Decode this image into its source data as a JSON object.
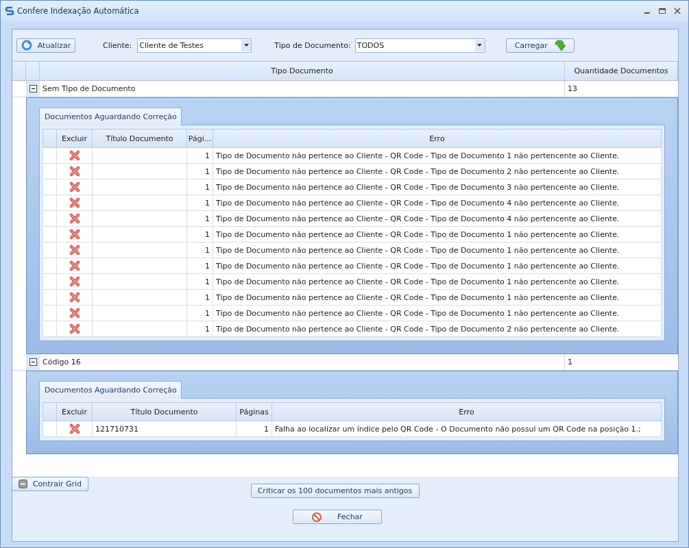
{
  "window": {
    "title": "Confere Indexação Automática"
  },
  "toolbar": {
    "refresh_button": "Atualizar",
    "client_label": "Cliente:",
    "client_value": "Cliente de Testes",
    "doctype_label": "Tipo de Documento:",
    "doctype_value": "TODOS",
    "load_button": "Carregar"
  },
  "grid": {
    "columns": [
      "Tipo Documento",
      "Quantidade Documentos"
    ],
    "groups": [
      {
        "name": "Sem Tipo de Documento",
        "count": "13",
        "expanded": true,
        "detail": {
          "tab": "Documentos Aguardando Correção",
          "columns": [
            "Excluir",
            "Título Documento",
            "Pági...",
            "Erro"
          ],
          "rows": [
            {
              "pages": "1",
              "error": "Tipo de Documento não pertence ao Cliente - QR Code - Tipo de Documento 1 não pertencente ao Cliente."
            },
            {
              "pages": "1",
              "error": "Tipo de Documento não pertence ao Cliente - QR Code - Tipo de Documento 2 não pertencente ao Cliente."
            },
            {
              "pages": "1",
              "error": "Tipo de Documento não pertence ao Cliente - QR Code - Tipo de Documento 3 não pertencente ao Cliente."
            },
            {
              "pages": "1",
              "error": "Tipo de Documento não pertence ao Cliente - QR Code - Tipo de Documento 4 não pertencente ao Cliente."
            },
            {
              "pages": "1",
              "error": "Tipo de Documento não pertence ao Cliente - QR Code - Tipo de Documento 4 não pertencente ao Cliente."
            },
            {
              "pages": "1",
              "error": "Tipo de Documento não pertence ao Cliente - QR Code - Tipo de Documento 1 não pertencente ao Cliente."
            },
            {
              "pages": "1",
              "error": "Tipo de Documento não pertence ao Cliente - QR Code - Tipo de Documento 1 não pertencente ao Cliente."
            },
            {
              "pages": "1",
              "error": "Tipo de Documento não pertence ao Cliente - QR Code - Tipo de Documento 1 não pertencente ao Cliente."
            },
            {
              "pages": "1",
              "error": "Tipo de Documento não pertence ao Cliente - QR Code - Tipo de Documento 1 não pertencente ao Cliente."
            },
            {
              "pages": "1",
              "error": "Tipo de Documento não pertence ao Cliente - QR Code - Tipo de Documento 1 não pertencente ao Cliente."
            },
            {
              "pages": "1",
              "error": "Tipo de Documento não pertence ao Cliente - QR Code - Tipo de Documento 1 não pertencente ao Cliente."
            },
            {
              "pages": "1",
              "error": "Tipo de Documento não pertence ao Cliente - QR Code - Tipo de Documento 2 não pertencente ao Cliente."
            }
          ]
        }
      },
      {
        "name": "Código 16",
        "count": "1",
        "expanded": true,
        "detail": {
          "tab": "Documentos Aguardando Correção",
          "columns": [
            "Excluir",
            "Título Documento",
            "Páginas",
            "Erro"
          ],
          "rows": [
            {
              "title": "121710731",
              "pages": "1",
              "error": "Falha ao localizar um índice pelo QR Code - O Documento não possui um QR Code na posição 1.;"
            }
          ]
        }
      }
    ]
  },
  "footer": {
    "collapse_button": "Contrair Grid",
    "critique_button": "Criticar os 100 documentos mais antigos",
    "close_button": "Fechar"
  }
}
